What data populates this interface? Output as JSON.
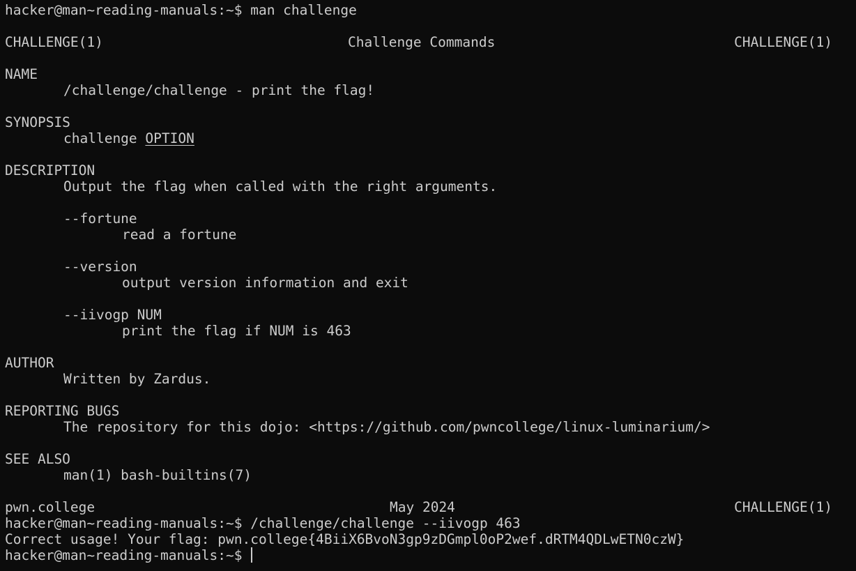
{
  "prompt": "hacker@man~reading-manuals:~$",
  "lines": {
    "cmd1": "man challenge",
    "header_left": "CHALLENGE(1)",
    "header_center": "Challenge Commands",
    "header_right": "CHALLENGE(1)",
    "name_heading": "NAME",
    "name_text": "/challenge/challenge - print the flag!",
    "synopsis_heading": "SYNOPSIS",
    "synopsis_cmd": "challenge",
    "synopsis_arg": "OPTION",
    "description_heading": "DESCRIPTION",
    "description_text": "Output the flag when called with the right arguments.",
    "opt1": "--fortune",
    "opt1_desc": "read a fortune",
    "opt2": "--version",
    "opt2_desc": "output version information and exit",
    "opt3": "--iivogp NUM",
    "opt3_desc": "print the flag if NUM is 463",
    "author_heading": "AUTHOR",
    "author_text": "Written by Zardus.",
    "bugs_heading": "REPORTING BUGS",
    "bugs_text": "The repository for this dojo: <https://github.com/pwncollege/linux-luminarium/>",
    "seealso_heading": "SEE ALSO",
    "seealso_text": "man(1) bash-builtins(7)",
    "footer_left": "pwn.college",
    "footer_center": "May 2024",
    "footer_right": "CHALLENGE(1)",
    "cmd2": "/challenge/challenge --iivogp 463",
    "output": "Correct usage! Your flag: pwn.college{4BiiX6BvoN3gp9zDGmpl0oP2wef.dRTM4QDLwETN0czW}",
    "cmd3": ""
  },
  "colors": {
    "background": "#0c0c0c",
    "foreground": "#cccccc"
  }
}
